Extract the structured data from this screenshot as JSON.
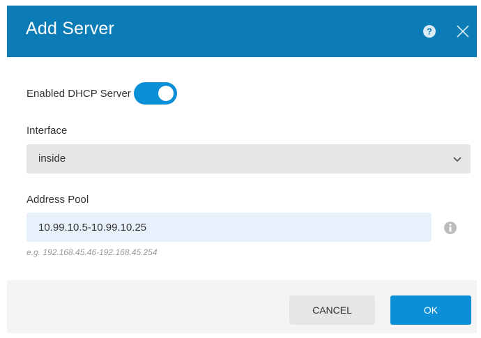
{
  "dialog": {
    "title": "Add Server",
    "help_icon": "help-icon",
    "close_icon": "close-icon"
  },
  "dhcp": {
    "label": "Enabled DHCP Server",
    "enabled": true
  },
  "interface": {
    "label": "Interface",
    "value": "inside"
  },
  "address_pool": {
    "label": "Address Pool",
    "value": "10.99.10.5-10.99.10.25",
    "hint": "e.g. 192.168.45.46-192.168.45.254"
  },
  "footer": {
    "cancel_label": "CANCEL",
    "ok_label": "OK"
  },
  "colors": {
    "header": "#0b7cb5",
    "accent": "#0b8fd6",
    "footer": "#f4f4f4"
  }
}
